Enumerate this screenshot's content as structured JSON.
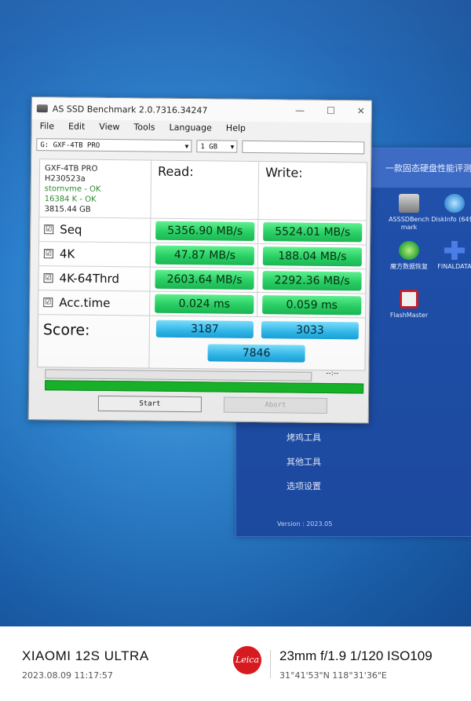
{
  "window": {
    "title": "AS SSD Benchmark 2.0.7316.34247",
    "controls": {
      "minimize": "—",
      "maximize": "☐",
      "close": "✕"
    }
  },
  "menu": [
    "File",
    "Edit",
    "View",
    "Tools",
    "Language",
    "Help"
  ],
  "toolbar": {
    "drive": "G: GXF-4TB PRO",
    "size": "1 GB",
    "text": ""
  },
  "drive_info": {
    "name": "GXF-4TB PRO",
    "firmware": "H230523a",
    "driver": "stornvme - OK",
    "alignment": "16384 K - OK",
    "capacity": "3815.44 GB"
  },
  "headers": {
    "read": "Read:",
    "write": "Write:"
  },
  "rows": [
    {
      "label": "Seq",
      "checked": "☑",
      "read": "5356.90 MB/s",
      "write": "5524.01 MB/s"
    },
    {
      "label": "4K",
      "checked": "☑",
      "read": "47.87 MB/s",
      "write": "188.04 MB/s"
    },
    {
      "label": "4K-64Thrd",
      "checked": "☑",
      "read": "2603.64 MB/s",
      "write": "2292.36 MB/s"
    },
    {
      "label": "Acc.time",
      "checked": "☑",
      "read": "0.024 ms",
      "write": "0.059 ms"
    }
  ],
  "score": {
    "label": "Score:",
    "read": "3187",
    "write": "3033",
    "total": "7846"
  },
  "progress": {
    "time": "--:--",
    "complete": 1.0
  },
  "buttons": {
    "start": "Start",
    "abort": "Abort"
  },
  "tool_window": {
    "header": "一款固态硬盘性能评测",
    "apps": [
      {
        "label": "ASSSDBench mark",
        "icon": "disk-icon"
      },
      {
        "label": "DiskInfo (64位)",
        "icon": "diskinfo-icon"
      },
      {
        "label": "魔方数据恢复",
        "icon": "recovery-icon"
      },
      {
        "label": "FINALDATA",
        "icon": "finaldata-icon"
      },
      {
        "label": "FlashMaster",
        "icon": "flashmaster-icon"
      }
    ],
    "menu": [
      "烤鸡工具",
      "其他工具",
      "选项设置"
    ],
    "version": "Version : 2023.05"
  },
  "caption": {
    "device": "XIAOMI 12S ULTRA",
    "datetime": "2023.08.09  11:17:57",
    "brand": "Leica",
    "specs": "23mm  f/1.9  1/120  ISO109",
    "gps": "31°41'53\"N  118°31'36\"E"
  },
  "colors": {
    "read_write_bar": "#27cf63",
    "score_bar": "#32b8ea",
    "progress": "#18b52a",
    "desktop": "#2f86d2",
    "leica": "#d71920"
  }
}
